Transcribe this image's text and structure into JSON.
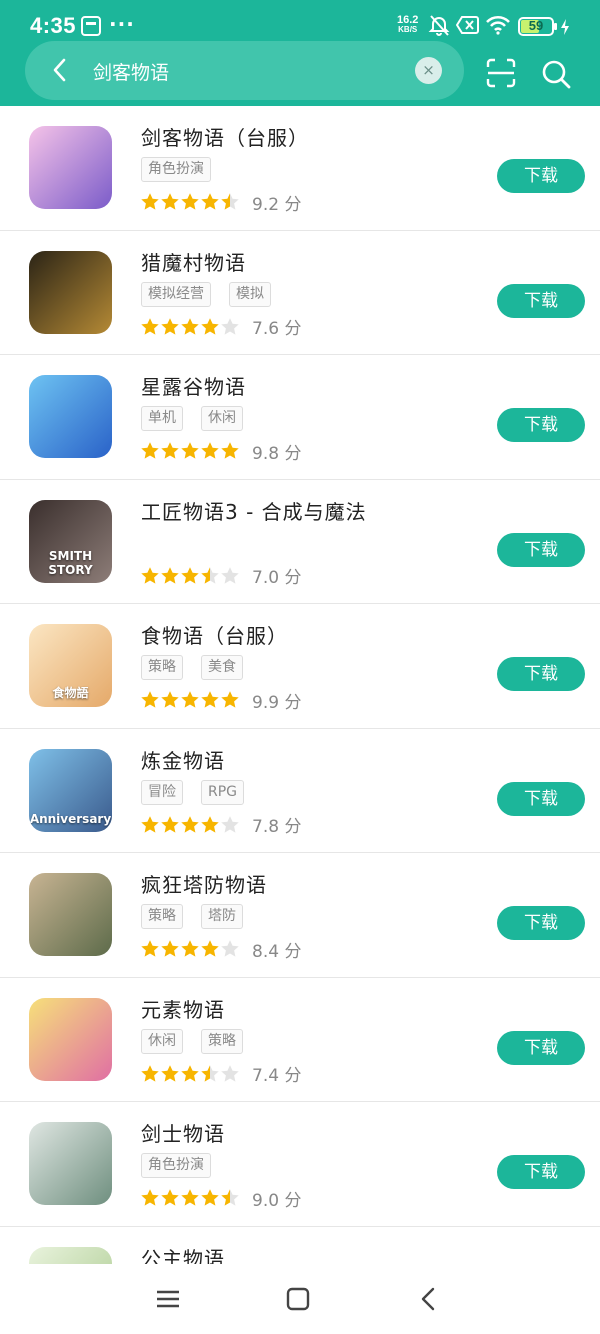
{
  "status_bar": {
    "time": "4:35",
    "more": "···",
    "speed_value": "16.2",
    "speed_unit": "KB/S",
    "battery_level": 59,
    "battery_text": "59"
  },
  "search": {
    "query": "剑客物语",
    "clear": "×"
  },
  "download_label": "下载",
  "apps": [
    {
      "name": "剑客物语（台服）",
      "tags": [
        "角色扮演"
      ],
      "rating": 4.5,
      "score": "9.2 分",
      "icon_colors": [
        "#f5c3e8",
        "#7b5cc9"
      ]
    },
    {
      "name": "猎魔村物语",
      "tags": [
        "模拟经营",
        "模拟"
      ],
      "rating": 4,
      "score": "7.6 分",
      "icon_colors": [
        "#2b2416",
        "#b58a35"
      ]
    },
    {
      "name": "星露谷物语",
      "tags": [
        "单机",
        "休闲"
      ],
      "rating": 5,
      "score": "9.8 分",
      "icon_colors": [
        "#6ec3f2",
        "#2a62c8"
      ]
    },
    {
      "name": "工匠物语3 - 合成与魔法",
      "tags": [],
      "rating": 3.5,
      "score": "7.0 分",
      "icon_colors": [
        "#3a2f2d",
        "#8d7d78"
      ],
      "icon_text": "SMITH STORY"
    },
    {
      "name": "食物语（台服）",
      "tags": [
        "策略",
        "美食"
      ],
      "rating": 5,
      "score": "9.9 分",
      "icon_colors": [
        "#fbe6c3",
        "#e5a969"
      ],
      "icon_text": "食物語"
    },
    {
      "name": "炼金物语",
      "tags": [
        "冒险",
        "RPG"
      ],
      "rating": 4,
      "score": "7.8 分",
      "icon_colors": [
        "#7fc0e8",
        "#3a5a8c"
      ],
      "icon_text": "Anniversary"
    },
    {
      "name": "疯狂塔防物语",
      "tags": [
        "策略",
        "塔防"
      ],
      "rating": 4,
      "score": "8.4 分",
      "icon_colors": [
        "#c8b493",
        "#5d6b4a"
      ]
    },
    {
      "name": "元素物语",
      "tags": [
        "休闲",
        "策略"
      ],
      "rating": 3.5,
      "score": "7.4 分",
      "icon_colors": [
        "#f6e07a",
        "#e06fa3"
      ]
    },
    {
      "name": "剑士物语",
      "tags": [
        "角色扮演"
      ],
      "rating": 4.5,
      "score": "9.0 分",
      "icon_colors": [
        "#dfe6e2",
        "#6f8f7f"
      ]
    },
    {
      "name": "公主物语",
      "tags": [],
      "rating": 0,
      "score": "",
      "icon_colors": [
        "#e9f3dd",
        "#a8c98c"
      ]
    }
  ],
  "colors": {
    "accent": "#1cb69a",
    "star_on": "#f7b500",
    "star_off": "#e3e3e3"
  }
}
